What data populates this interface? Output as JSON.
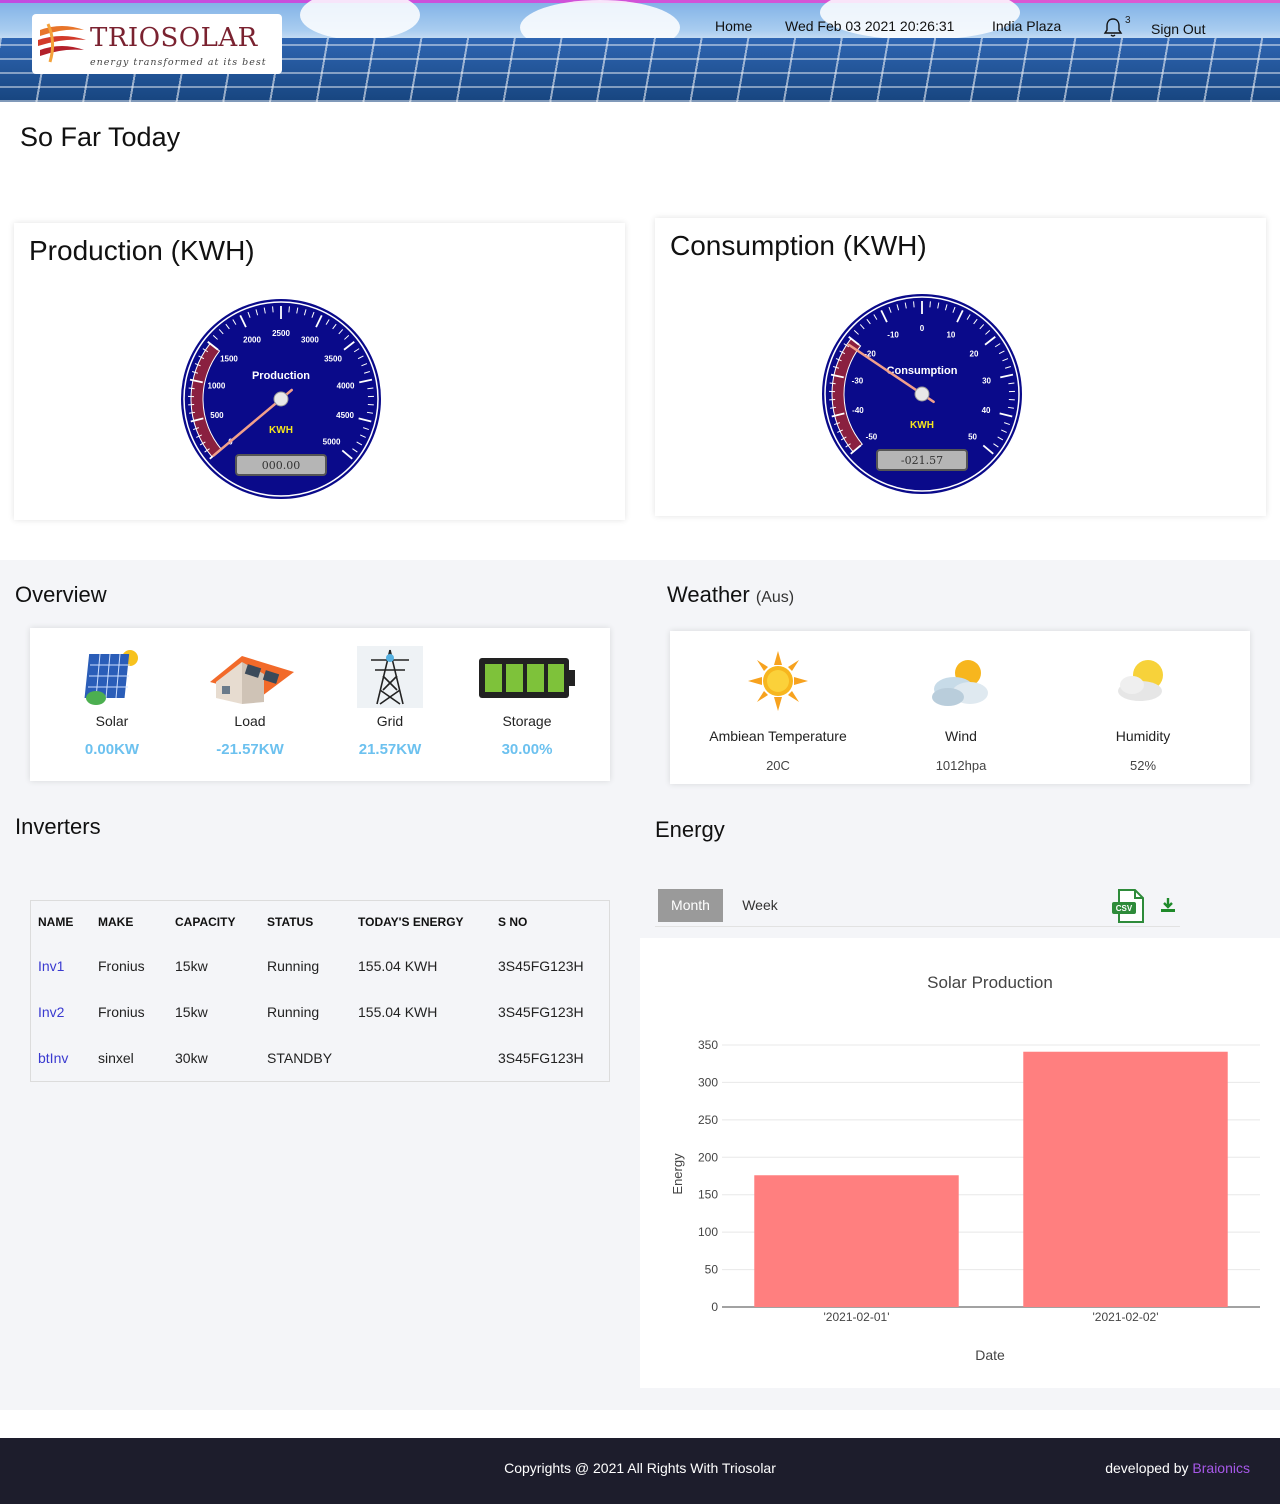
{
  "header": {
    "logo_name": "TRIOSOLAR",
    "logo_tagline": "energy transformed at its best",
    "nav_home": "Home",
    "datetime": "Wed Feb 03 2021 20:26:31",
    "location": "India Plaza",
    "notification_count": "3",
    "sign_out": "Sign Out"
  },
  "page_title": "So Far Today",
  "production_gauge": {
    "title": "Production (KWH)",
    "center_label": "Production",
    "unit": "KWH",
    "ticks": [
      "0",
      "500",
      "1000",
      "1500",
      "2000",
      "2500",
      "3000",
      "3500",
      "4000",
      "4500",
      "5000"
    ],
    "min": 0,
    "max": 5000,
    "value": 0,
    "readout": "000.00"
  },
  "consumption_gauge": {
    "title": "Consumption (KWH)",
    "center_label": "Consumption",
    "unit": "KWH",
    "ticks": [
      "-50",
      "-40",
      "-30",
      "-20",
      "-10",
      "0",
      "10",
      "20",
      "30",
      "40",
      "50"
    ],
    "min": -50,
    "max": 50,
    "value": -21.57,
    "readout": "-021.57"
  },
  "overview": {
    "title": "Overview",
    "items": [
      {
        "label": "Solar",
        "value": "0.00KW",
        "icon": "solar-panel-icon"
      },
      {
        "label": "Load",
        "value": "-21.57KW",
        "icon": "house-icon"
      },
      {
        "label": "Grid",
        "value": "21.57KW",
        "icon": "power-tower-icon"
      },
      {
        "label": "Storage",
        "value": "30.00%",
        "icon": "battery-icon"
      }
    ]
  },
  "weather": {
    "title": "Weather",
    "region": "(Aus)",
    "items": [
      {
        "label": "Ambiean Temperature",
        "value": "20C",
        "icon": "sun-icon"
      },
      {
        "label": "Wind",
        "value": "1012hpa",
        "icon": "cloudy-sun-icon"
      },
      {
        "label": "Humidity",
        "value": "52%",
        "icon": "partly-cloudy-icon"
      }
    ]
  },
  "inverters": {
    "title": "Inverters",
    "columns": [
      "NAME",
      "MAKE",
      "CAPACITY",
      "STATUS",
      "TODAY'S ENERGY",
      "S NO"
    ],
    "rows": [
      [
        "Inv1",
        "Fronius",
        "15kw",
        "Running",
        "155.04 KWH",
        "3S45FG123H"
      ],
      [
        "Inv2",
        "Fronius",
        "15kw",
        "Running",
        "155.04 KWH",
        "3S45FG123H"
      ],
      [
        "btInv",
        "sinxel",
        "30kw",
        "STANDBY",
        "",
        "3S45FG123H"
      ]
    ]
  },
  "energy": {
    "title": "Energy",
    "tabs": [
      "Month",
      "Week"
    ],
    "active_tab": "Month",
    "csv_icon": "csv-file-icon",
    "download_icon": "download-icon",
    "accent_color": "#ff7f7f"
  },
  "chart_data": {
    "type": "bar",
    "title": "Solar Production",
    "categories": [
      "'2021-02-01'",
      "'2021-02-02'"
    ],
    "values": [
      176,
      341
    ],
    "xlabel": "Date",
    "ylabel": "Energy",
    "ylim": [
      0,
      350
    ],
    "yticks": [
      "0",
      "50",
      "100",
      "150",
      "200",
      "250",
      "300",
      "350"
    ],
    "grid": true,
    "color": "#ff7f7f"
  },
  "footer": {
    "copyright": "Copyrights @ 2021 All Rights With Triosolar",
    "developed_by": "developed by ",
    "developer": "Braionics"
  }
}
